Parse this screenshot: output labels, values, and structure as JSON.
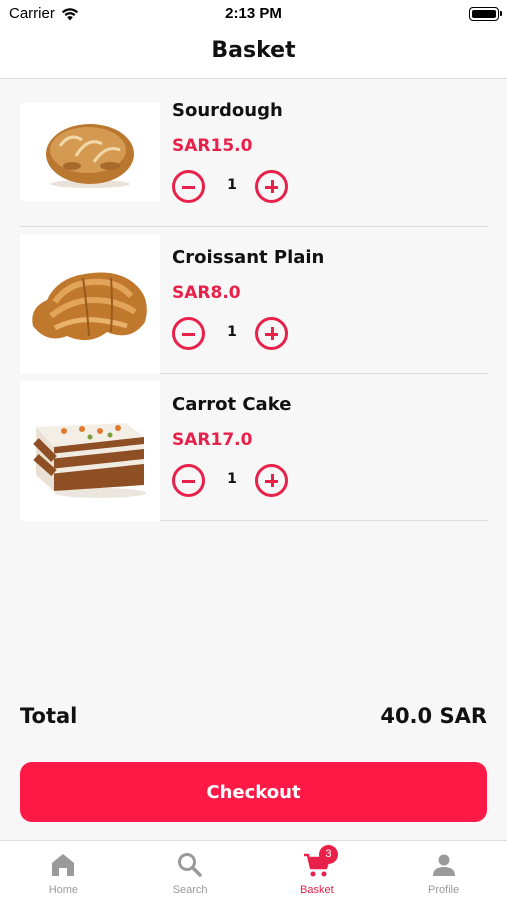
{
  "status_bar": {
    "carrier": "Carrier",
    "time": "2:13 PM"
  },
  "header": {
    "title": "Basket"
  },
  "items": [
    {
      "name": "Sourdough",
      "price": "SAR15.0",
      "quantity": "1"
    },
    {
      "name": "Croissant Plain",
      "price": "SAR8.0",
      "quantity": "1"
    },
    {
      "name": "Carrot Cake",
      "price": "SAR17.0",
      "quantity": "1"
    }
  ],
  "total": {
    "label": "Total",
    "value": "40.0 SAR"
  },
  "checkout": {
    "label": "Checkout"
  },
  "tab_bar": {
    "tabs": [
      {
        "label": "Home",
        "icon": "home-icon"
      },
      {
        "label": "Search",
        "icon": "search-icon"
      },
      {
        "label": "Basket",
        "icon": "cart-icon",
        "badge": "3"
      },
      {
        "label": "Profile",
        "icon": "person-icon"
      }
    ],
    "active": "Basket"
  },
  "colors": {
    "accent": "#e8214a",
    "button": "#fe1947",
    "inactive": "#9a9a9a",
    "background": "#f7f7f7"
  }
}
